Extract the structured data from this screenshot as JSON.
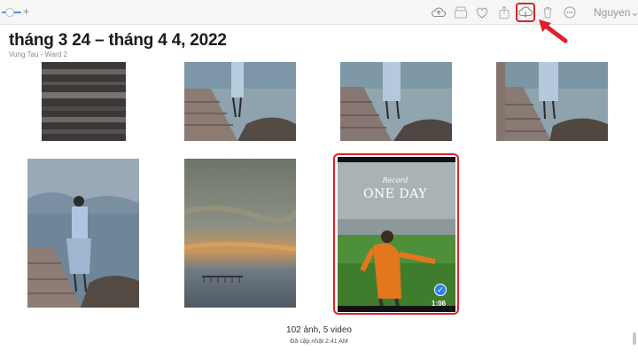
{
  "toolbar": {
    "icons": [
      "icloud-upload-icon",
      "slideshow-icon",
      "favorite-heart-icon",
      "share-icon",
      "download-icon",
      "trash-icon",
      "more-icon"
    ],
    "user_menu": "Nguyen",
    "user_menu_chevron": "⌄",
    "zoom_plus": "+"
  },
  "header": {
    "title": "tháng 3 24 – tháng 4 4, 2022",
    "subtitle": "Vung Tau - Ward 2"
  },
  "video": {
    "overlay_line1": "Record",
    "overlay_line2": "ONE DAY",
    "duration": "1:06",
    "check_glyph": "✓"
  },
  "footer": {
    "count": "102 ảnh, 5 video",
    "updated": "Đã cập nhật 2:41 AM"
  },
  "colors": {
    "accent": "#2d7ff9",
    "highlight": "#e0202a"
  }
}
